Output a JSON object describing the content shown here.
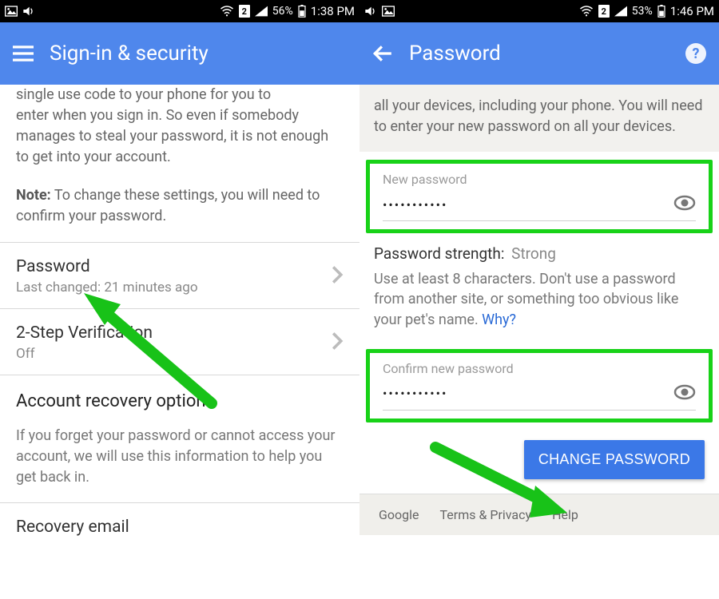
{
  "left": {
    "statusbar": {
      "battery": "56%",
      "time": "1:38 PM"
    },
    "appbar": {
      "title": "Sign-in & security"
    },
    "intro_line1": "enter when you sign in. So even if somebody manages to steal your password, it is not enough to get into your account.",
    "intro_cut": "single use code to your phone for you to",
    "note_label": "Note:",
    "note_text": " To change these settings, you will need to confirm your password.",
    "items": {
      "password": {
        "title": "Password",
        "sub": "Last changed: 21 minutes ago"
      },
      "twostep": {
        "title": "2-Step Verification",
        "sub": "Off"
      }
    },
    "recovery": {
      "heading": "Account recovery options",
      "body": "If you forget your password or cannot access your account, we will use this information to help you get back in.",
      "email_heading": "Recovery email"
    }
  },
  "right": {
    "statusbar": {
      "battery": "53%",
      "time": "1:46 PM"
    },
    "appbar": {
      "title": "Password"
    },
    "intro": "all your devices, including your phone. You will need to enter your new password on all your devices.",
    "new_pw": {
      "label": "New password",
      "value": "•••••••••••"
    },
    "strength": {
      "label": "Password strength:",
      "value": "Strong"
    },
    "advice": "Use at least 8 characters. Don't use a password from another site, or something too obvious like your pet's name. ",
    "why": "Why?",
    "confirm_pw": {
      "label": "Confirm new password",
      "value": "•••••••••••"
    },
    "change_btn": "CHANGE PASSWORD",
    "footer": {
      "google": "Google",
      "terms": "Terms & Privacy",
      "help": "Help"
    }
  }
}
